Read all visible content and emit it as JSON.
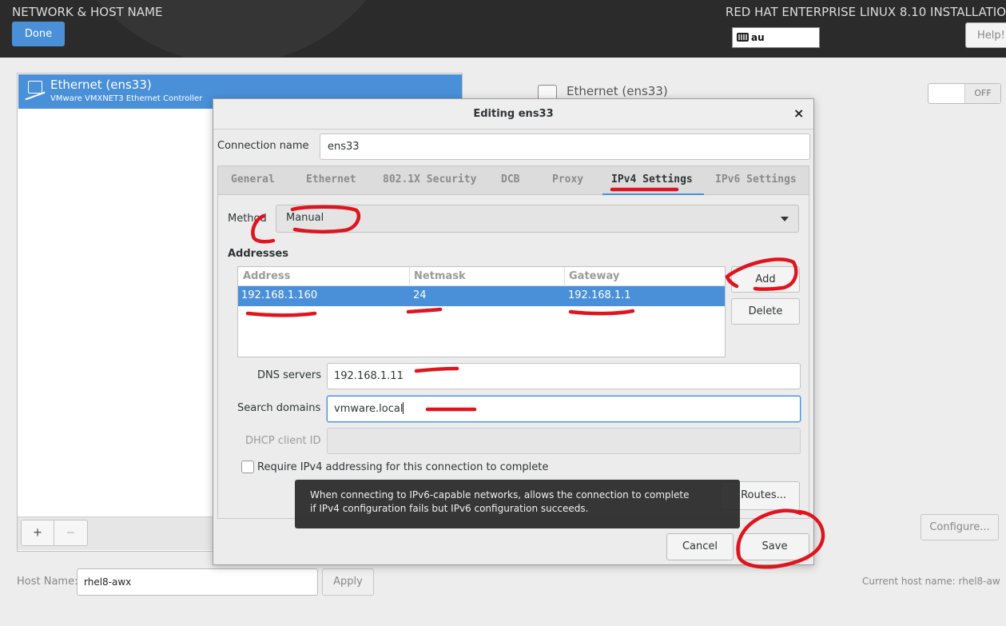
{
  "header": {
    "title": "NETWORK & HOST NAME",
    "done_label": "Done",
    "product": "RED HAT ENTERPRISE LINUX 8.10 INSTALLATIO",
    "keyboard_layout": "au",
    "help_label": "Help!"
  },
  "device_list": {
    "items": [
      {
        "name": "Ethernet (ens33)",
        "description": "VMware VMXNET3 Ethernet Controller",
        "icon": "ethernet-icon"
      }
    ],
    "add_label": "+",
    "remove_label": "−"
  },
  "device_detail": {
    "name": "Ethernet (ens33)",
    "toggle_state": "OFF",
    "configure_label": "Configure..."
  },
  "hostname": {
    "label": "Host Name:",
    "value": "rhel8-awx",
    "apply_label": "Apply",
    "current": "Current host name:   rhel8-aw"
  },
  "dialog": {
    "title": "Editing ens33",
    "close_label": "×",
    "connection_name_label": "Connection name",
    "connection_name_value": "ens33",
    "tabs": [
      {
        "label": "General"
      },
      {
        "label": "Ethernet"
      },
      {
        "label": "802.1X Security"
      },
      {
        "label": "DCB"
      },
      {
        "label": "Proxy"
      },
      {
        "label": "IPv4 Settings",
        "active": true
      },
      {
        "label": "IPv6 Settings"
      }
    ],
    "ipv4": {
      "method_label": "Method",
      "method_value": "Manual",
      "addresses_title": "Addresses",
      "columns": [
        "Address",
        "Netmask",
        "Gateway"
      ],
      "rows": [
        {
          "address": "192.168.1.160",
          "netmask": "24",
          "gateway": "192.168.1.1"
        }
      ],
      "add_label": "Add",
      "delete_label": "Delete",
      "dns_label": "DNS servers",
      "dns_value": "192.168.1.11",
      "search_label": "Search domains",
      "search_value": "vmware.local",
      "dhcp_label": "DHCP client ID",
      "dhcp_value": "",
      "require_label": "Require IPv4 addressing for this connection to complete",
      "require_checked": false,
      "routes_label": "Routes..."
    },
    "cancel_label": "Cancel",
    "save_label": "Save"
  },
  "tooltip": {
    "line1": "When connecting to IPv6-capable networks, allows the connection to complete",
    "line2": "if IPv4 configuration fails but IPv6 configuration succeeds."
  },
  "colors": {
    "accent": "#4a90d9",
    "header_bg": "#2b2b2b",
    "annotation": "#e0141e"
  }
}
